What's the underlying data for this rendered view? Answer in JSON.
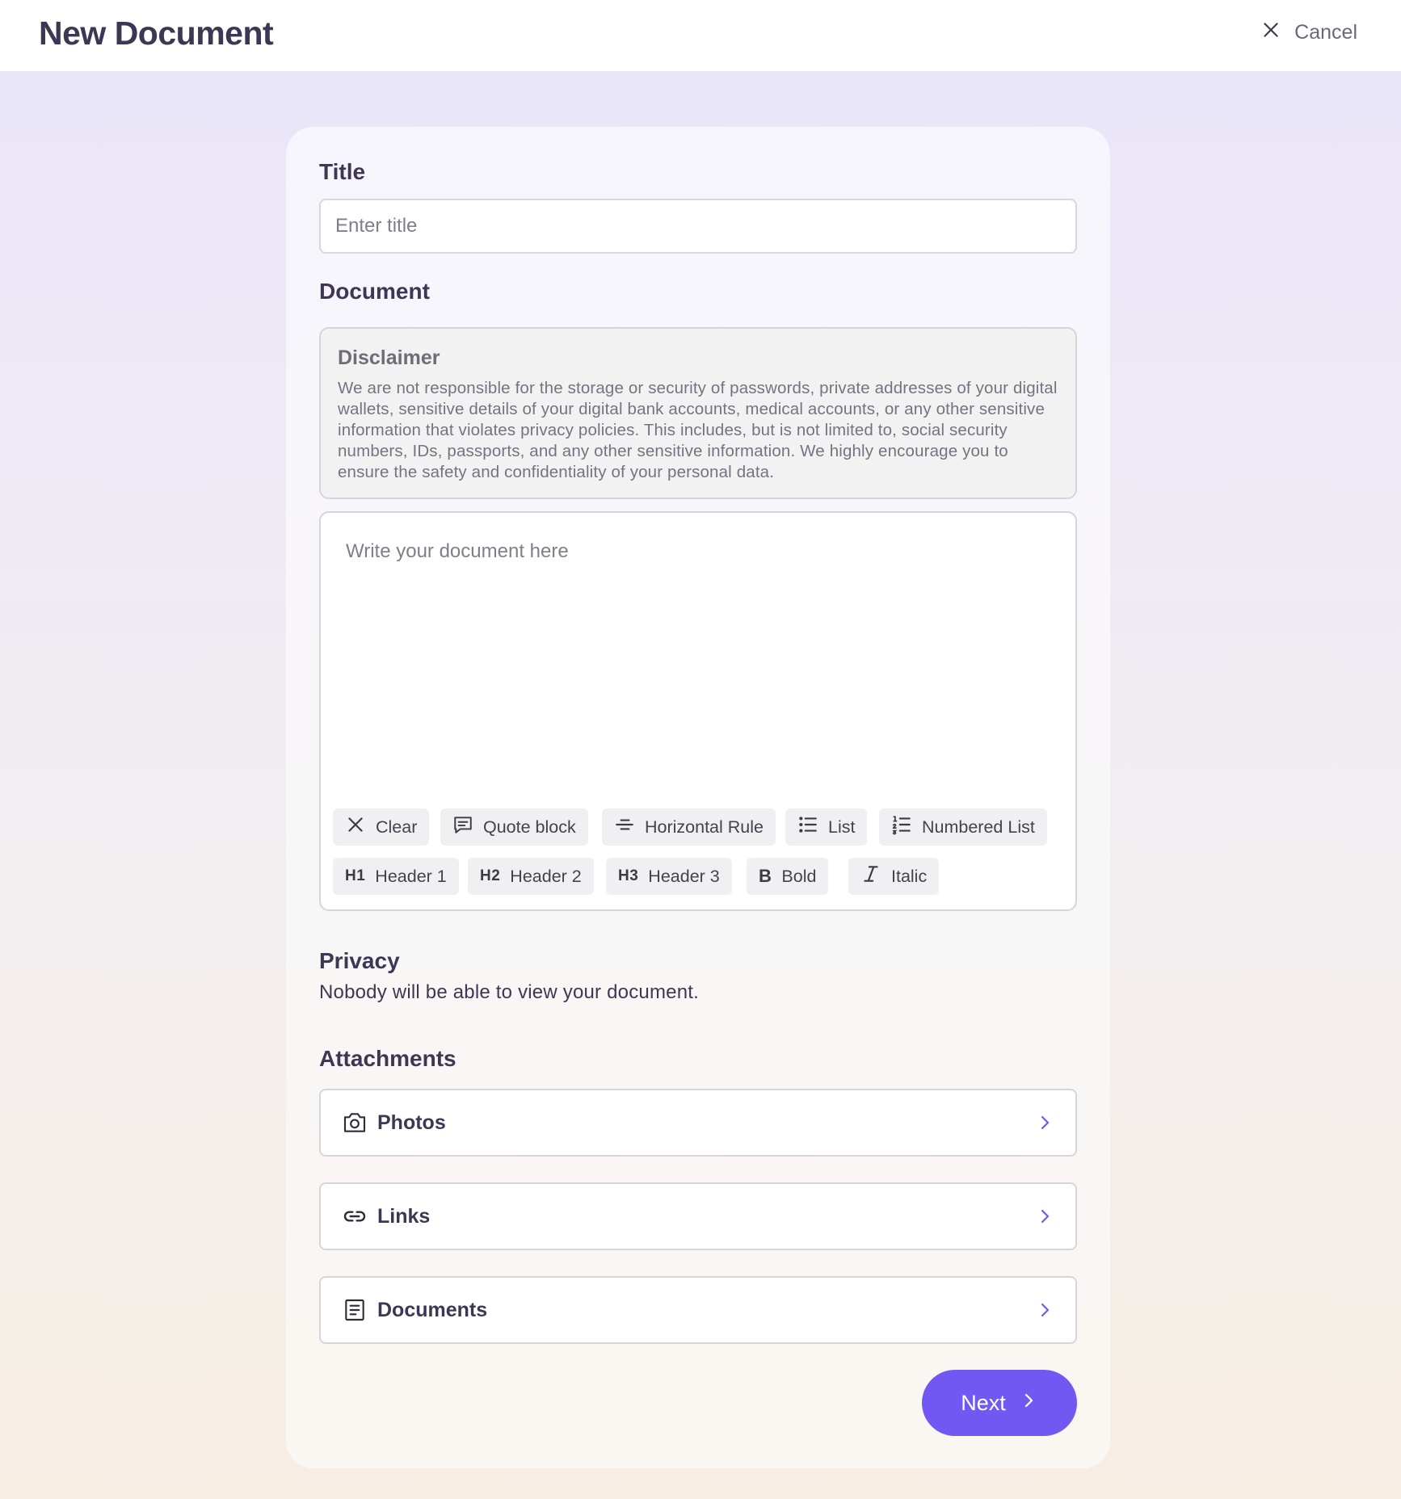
{
  "header": {
    "title": "New Document",
    "cancel_label": "Cancel"
  },
  "form": {
    "title_label": "Title",
    "title_placeholder": "Enter title",
    "title_value": "",
    "document_label": "Document",
    "disclaimer": {
      "title": "Disclaimer",
      "text": "We are not responsible for the storage or security of passwords, private addresses of your digital wallets, sensitive details of your digital bank accounts, medical accounts, or any other sensitive information that violates privacy policies. This includes, but is not limited to, social security numbers, IDs, passports, and any other sensitive information. We highly encourage you to ensure the safety and confidentiality of your personal data."
    },
    "editor": {
      "placeholder": "Write your document here",
      "value": ""
    },
    "toolbar": [
      {
        "label": "Clear",
        "icon": "close-icon"
      },
      {
        "label": "Quote block",
        "icon": "quote-icon"
      },
      {
        "label": "Horizontal Rule",
        "icon": "horizontal-rule-icon"
      },
      {
        "label": "List",
        "icon": "bullet-list-icon"
      },
      {
        "label": "Numbered List",
        "icon": "numbered-list-icon"
      },
      {
        "label": "Header 1",
        "icon_text": "H1"
      },
      {
        "label": "Header 2",
        "icon_text": "H2"
      },
      {
        "label": "Header 3",
        "icon_text": "H3"
      },
      {
        "label": "Bold",
        "icon_text": "B"
      },
      {
        "label": "Italic",
        "icon": "italic-icon"
      }
    ],
    "privacy": {
      "label": "Privacy",
      "text": "Nobody will be able to view your document."
    },
    "attachments": {
      "label": "Attachments",
      "items": [
        {
          "label": "Photos",
          "icon": "camera-icon"
        },
        {
          "label": "Links",
          "icon": "link-icon"
        },
        {
          "label": "Documents",
          "icon": "document-icon"
        }
      ]
    },
    "next_label": "Next"
  },
  "colors": {
    "accent": "#7158f3",
    "text": "#3d3753",
    "muted": "#757380"
  }
}
